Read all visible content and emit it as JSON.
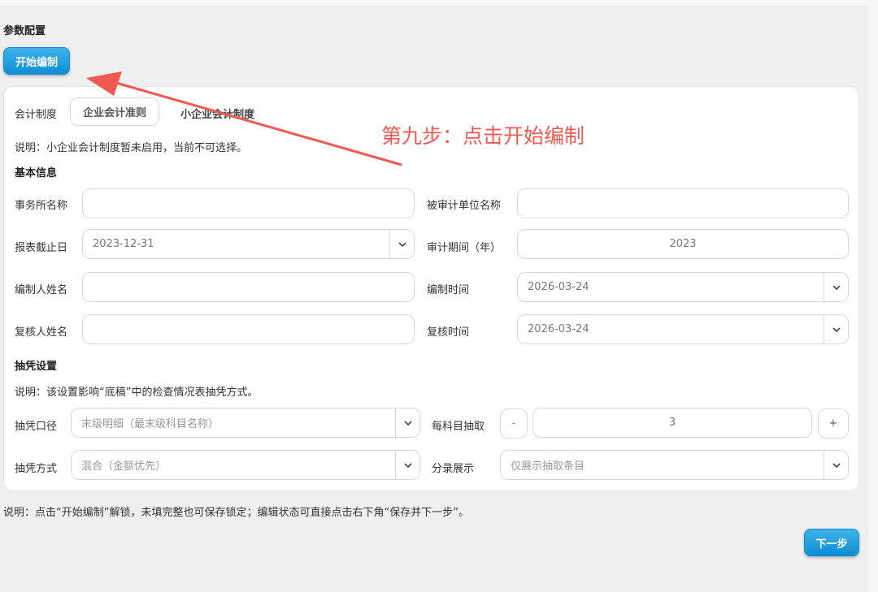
{
  "page": {
    "section_title": "参数配置",
    "start_button": "开始编制",
    "next_button": "下一步",
    "footer_note": "说明：点击“开始编制”解锁，未填完整也可保存锁定；编辑状态可直接点击右下角“保存并下一步”。"
  },
  "accounting": {
    "label": "会计制度",
    "options": [
      "企业会计准则",
      "小企业会计制度"
    ],
    "selected": "企业会计准则",
    "note": "说明：小企业会计制度暂未启用，当前不可选择。"
  },
  "basic": {
    "title": "基本信息",
    "firm_name_label": "事务所名称",
    "firm_name_value": "",
    "audited_unit_label": "被审计单位名称",
    "audited_unit_value": "",
    "report_date_label": "报表截止日",
    "report_date_value": "2023-12-31",
    "audit_period_label": "审计期间（年）",
    "audit_period_value": "2023",
    "preparer_label": "编制人姓名",
    "preparer_value": "",
    "prepare_time_label": "编制时间",
    "prepare_time_value": "2026-03-24",
    "reviewer_label": "复核人姓名",
    "reviewer_value": "",
    "review_time_label": "复核时间",
    "review_time_value": "2026-03-24"
  },
  "sampling": {
    "title": "抽凭设置",
    "note": "说明：该设置影响“底稿”中的检查情况表抽凭方式。",
    "scope_label": "抽凭口径",
    "scope_placeholder": "末级明细（最末级科目名称）",
    "per_subject_label": "每科目抽取",
    "minus": "-",
    "count": "3",
    "plus": "+",
    "method_label": "抽凭方式",
    "method_placeholder": "混合（金额优先）",
    "display_label": "分录展示",
    "display_placeholder": "仅展示抽取条目"
  },
  "annotation": {
    "text": "第九步：点击开始编制",
    "color": "#ee5a52"
  },
  "colors": {
    "primary": "#1a9ad9",
    "annotation": "#ee5a52"
  }
}
